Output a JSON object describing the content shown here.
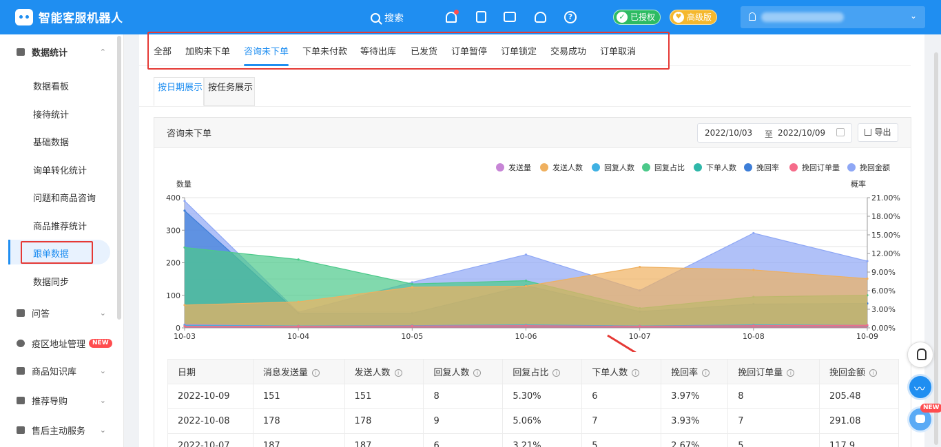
{
  "app": {
    "title": "智能客服机器人"
  },
  "header": {
    "search_label": "搜索",
    "auth_badge": "已授权",
    "version_badge": "高级版"
  },
  "sidebar": {
    "stats_group": "数据统计",
    "stats_items": [
      "数据看板",
      "接待统计",
      "基础数据",
      "询单转化统计",
      "问题和商品咨询",
      "商品推荐统计",
      "跟单数据",
      "数据同步"
    ],
    "active_item": "跟单数据",
    "groups": [
      {
        "label": "问答",
        "has_arrow": true,
        "icon": "chat-icon"
      },
      {
        "label": "疫区地址管理",
        "has_arrow": false,
        "badge": "NEW",
        "icon": "location-icon"
      },
      {
        "label": "商品知识库",
        "has_arrow": true,
        "icon": "box-icon"
      },
      {
        "label": "推荐导购",
        "has_arrow": true,
        "icon": "guide-icon"
      },
      {
        "label": "售后主动服务",
        "has_arrow": true,
        "icon": "service-icon"
      }
    ]
  },
  "tabs": [
    "全部",
    "加购未下单",
    "咨询未下单",
    "下单未付款",
    "等待出库",
    "已发货",
    "订单暂停",
    "订单锁定",
    "交易成功",
    "订单取消"
  ],
  "active_tab": "咨询未下单",
  "subtabs": [
    "按日期展示",
    "按任务展示"
  ],
  "active_subtab": "按日期展示",
  "panel": {
    "title": "咨询未下单",
    "date_start": "2022/10/03",
    "date_sep": "至",
    "date_end": "2022/10/09",
    "export_label": "导出"
  },
  "chart_data": {
    "type": "area",
    "left_axis_label": "数量",
    "right_axis_label": "概率",
    "ylim": [
      0,
      400
    ],
    "y2lim": [
      0,
      21
    ],
    "yticks": [
      "0",
      "100",
      "200",
      "300",
      "400"
    ],
    "y2ticks": [
      "0.00%",
      "3.00%",
      "6.00%",
      "9.00%",
      "12.00%",
      "15.00%",
      "18.00%",
      "21.00%"
    ],
    "categories": [
      "10-03",
      "10-04",
      "10-05",
      "10-06",
      "10-07",
      "10-08",
      "10-09"
    ],
    "legend_position": "top-right",
    "grid": true,
    "series": [
      {
        "name": "发送量",
        "color": "#c785d6",
        "values": [
          10,
          5,
          5,
          8,
          5,
          5,
          5
        ]
      },
      {
        "name": "发送人数",
        "color": "#efb05f",
        "values": [
          70,
          80,
          125,
          128,
          187,
          178,
          151
        ]
      },
      {
        "name": "回复人数",
        "color": "#3fb1e3",
        "values": [
          8,
          6,
          7,
          9,
          6,
          9,
          8
        ]
      },
      {
        "name": "回复占比",
        "color": "#4cc98a",
        "values": [
          247,
          210,
          135,
          145,
          60,
          95,
          100
        ]
      },
      {
        "name": "下单人数",
        "color": "#2fb7a9",
        "values": [
          5,
          5,
          6,
          6,
          5,
          7,
          6
        ]
      },
      {
        "name": "挽回率",
        "color": "#3d7ed8",
        "values": [
          360,
          45,
          45,
          130,
          50,
          73,
          75
        ]
      },
      {
        "name": "挽回订单量",
        "color": "#f56c8a",
        "values": [
          5,
          5,
          6,
          7,
          5,
          7,
          8
        ]
      },
      {
        "name": "挽回金额",
        "color": "#8ea7f5",
        "values": [
          390,
          48,
          140,
          225,
          115,
          291,
          205
        ]
      }
    ]
  },
  "table": {
    "columns": [
      "日期",
      "消息发送量",
      "发送人数",
      "回复人数",
      "回复占比",
      "下单人数",
      "挽回率",
      "挽回订单量",
      "挽回金额"
    ],
    "info_columns": [
      false,
      true,
      true,
      true,
      true,
      true,
      true,
      true,
      true
    ],
    "rows": [
      [
        "2022-10-09",
        "151",
        "151",
        "8",
        "5.30%",
        "6",
        "3.97%",
        "8",
        "205.48"
      ],
      [
        "2022-10-08",
        "178",
        "178",
        "9",
        "5.06%",
        "7",
        "3.93%",
        "7",
        "291.08"
      ],
      [
        "2022-10-07",
        "187",
        "187",
        "6",
        "3.21%",
        "5",
        "2.67%",
        "5",
        "117.9"
      ]
    ]
  },
  "floating": {
    "new_badge": "NEW"
  }
}
